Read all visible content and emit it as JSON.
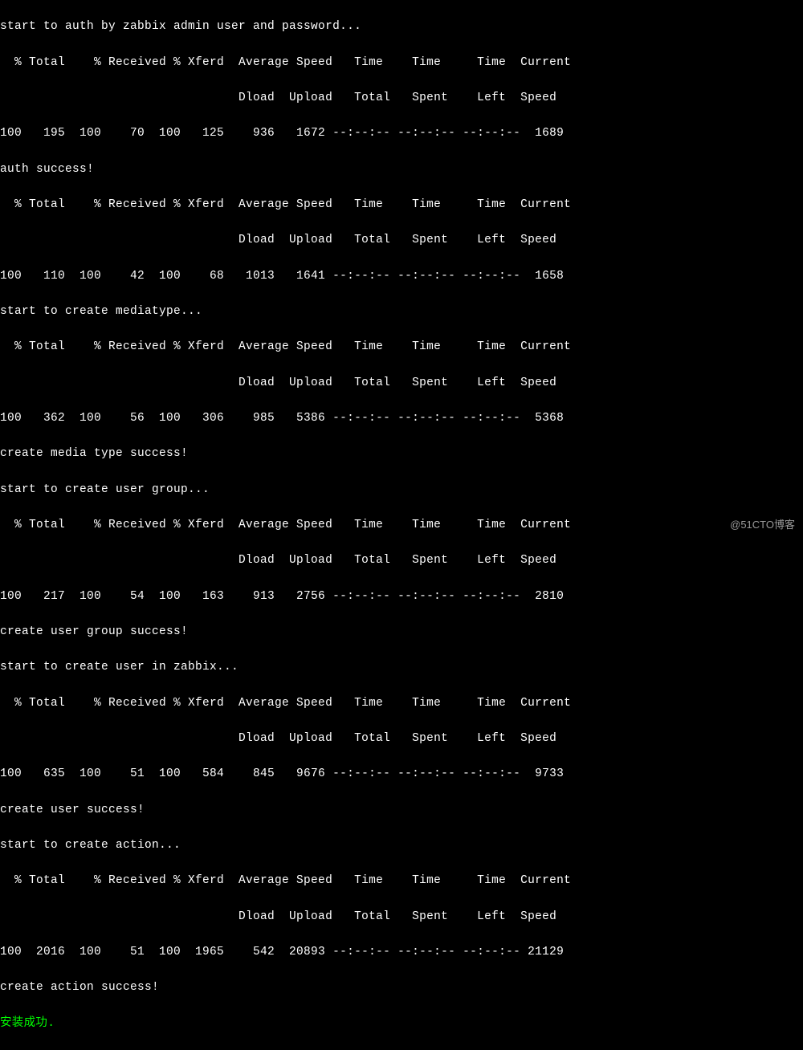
{
  "msg_auth_start": "start to auth by zabbix admin user and password...",
  "hdr1_a": "  % Total    % Received % Xferd  Average Speed   Time    Time     Time  Current",
  "hdr1_b": "                                 Dload  Upload   Total   Spent    Left  Speed",
  "row1": "100   195  100    70  100   125    936   1672 --:--:-- --:--:-- --:--:--  1689",
  "msg_auth_ok": "auth success!",
  "hdr2_a": "  % Total    % Received % Xferd  Average Speed   Time    Time     Time  Current",
  "hdr2_b": "                                 Dload  Upload   Total   Spent    Left  Speed",
  "row2": "100   110  100    42  100    68   1013   1641 --:--:-- --:--:-- --:--:--  1658",
  "msg_media_start": "start to create mediatype...",
  "hdr3_a": "  % Total    % Received % Xferd  Average Speed   Time    Time     Time  Current",
  "hdr3_b": "                                 Dload  Upload   Total   Spent    Left  Speed",
  "row3": "100   362  100    56  100   306    985   5386 --:--:-- --:--:-- --:--:--  5368",
  "msg_media_ok": "create media type success!",
  "msg_ugroup_start": "start to create user group...",
  "hdr4_a": "  % Total    % Received % Xferd  Average Speed   Time    Time     Time  Current",
  "hdr4_b": "                                 Dload  Upload   Total   Spent    Left  Speed",
  "row4": "100   217  100    54  100   163    913   2756 --:--:-- --:--:-- --:--:--  2810",
  "msg_ugroup_ok": "create user group success!",
  "msg_user_start": "start to create user in zabbix...",
  "hdr5_a": "  % Total    % Received % Xferd  Average Speed   Time    Time     Time  Current",
  "hdr5_b": "                                 Dload  Upload   Total   Spent    Left  Speed",
  "row5": "100   635  100    51  100   584    845   9676 --:--:-- --:--:-- --:--:--  9733",
  "msg_user_ok": "create user success!",
  "msg_action_start": "start to create action...",
  "hdr6_a": "  % Total    % Received % Xferd  Average Speed   Time    Time     Time  Current",
  "hdr6_b": "                                 Dload  Upload   Total   Spent    Left  Speed",
  "row6": "100  2016  100    51  100  1965    542  20893 --:--:-- --:--:-- --:--:-- 21129",
  "msg_action_ok": "create action success!",
  "msg_install_ok": "安装成功.",
  "watermark": "@51CTO博客"
}
